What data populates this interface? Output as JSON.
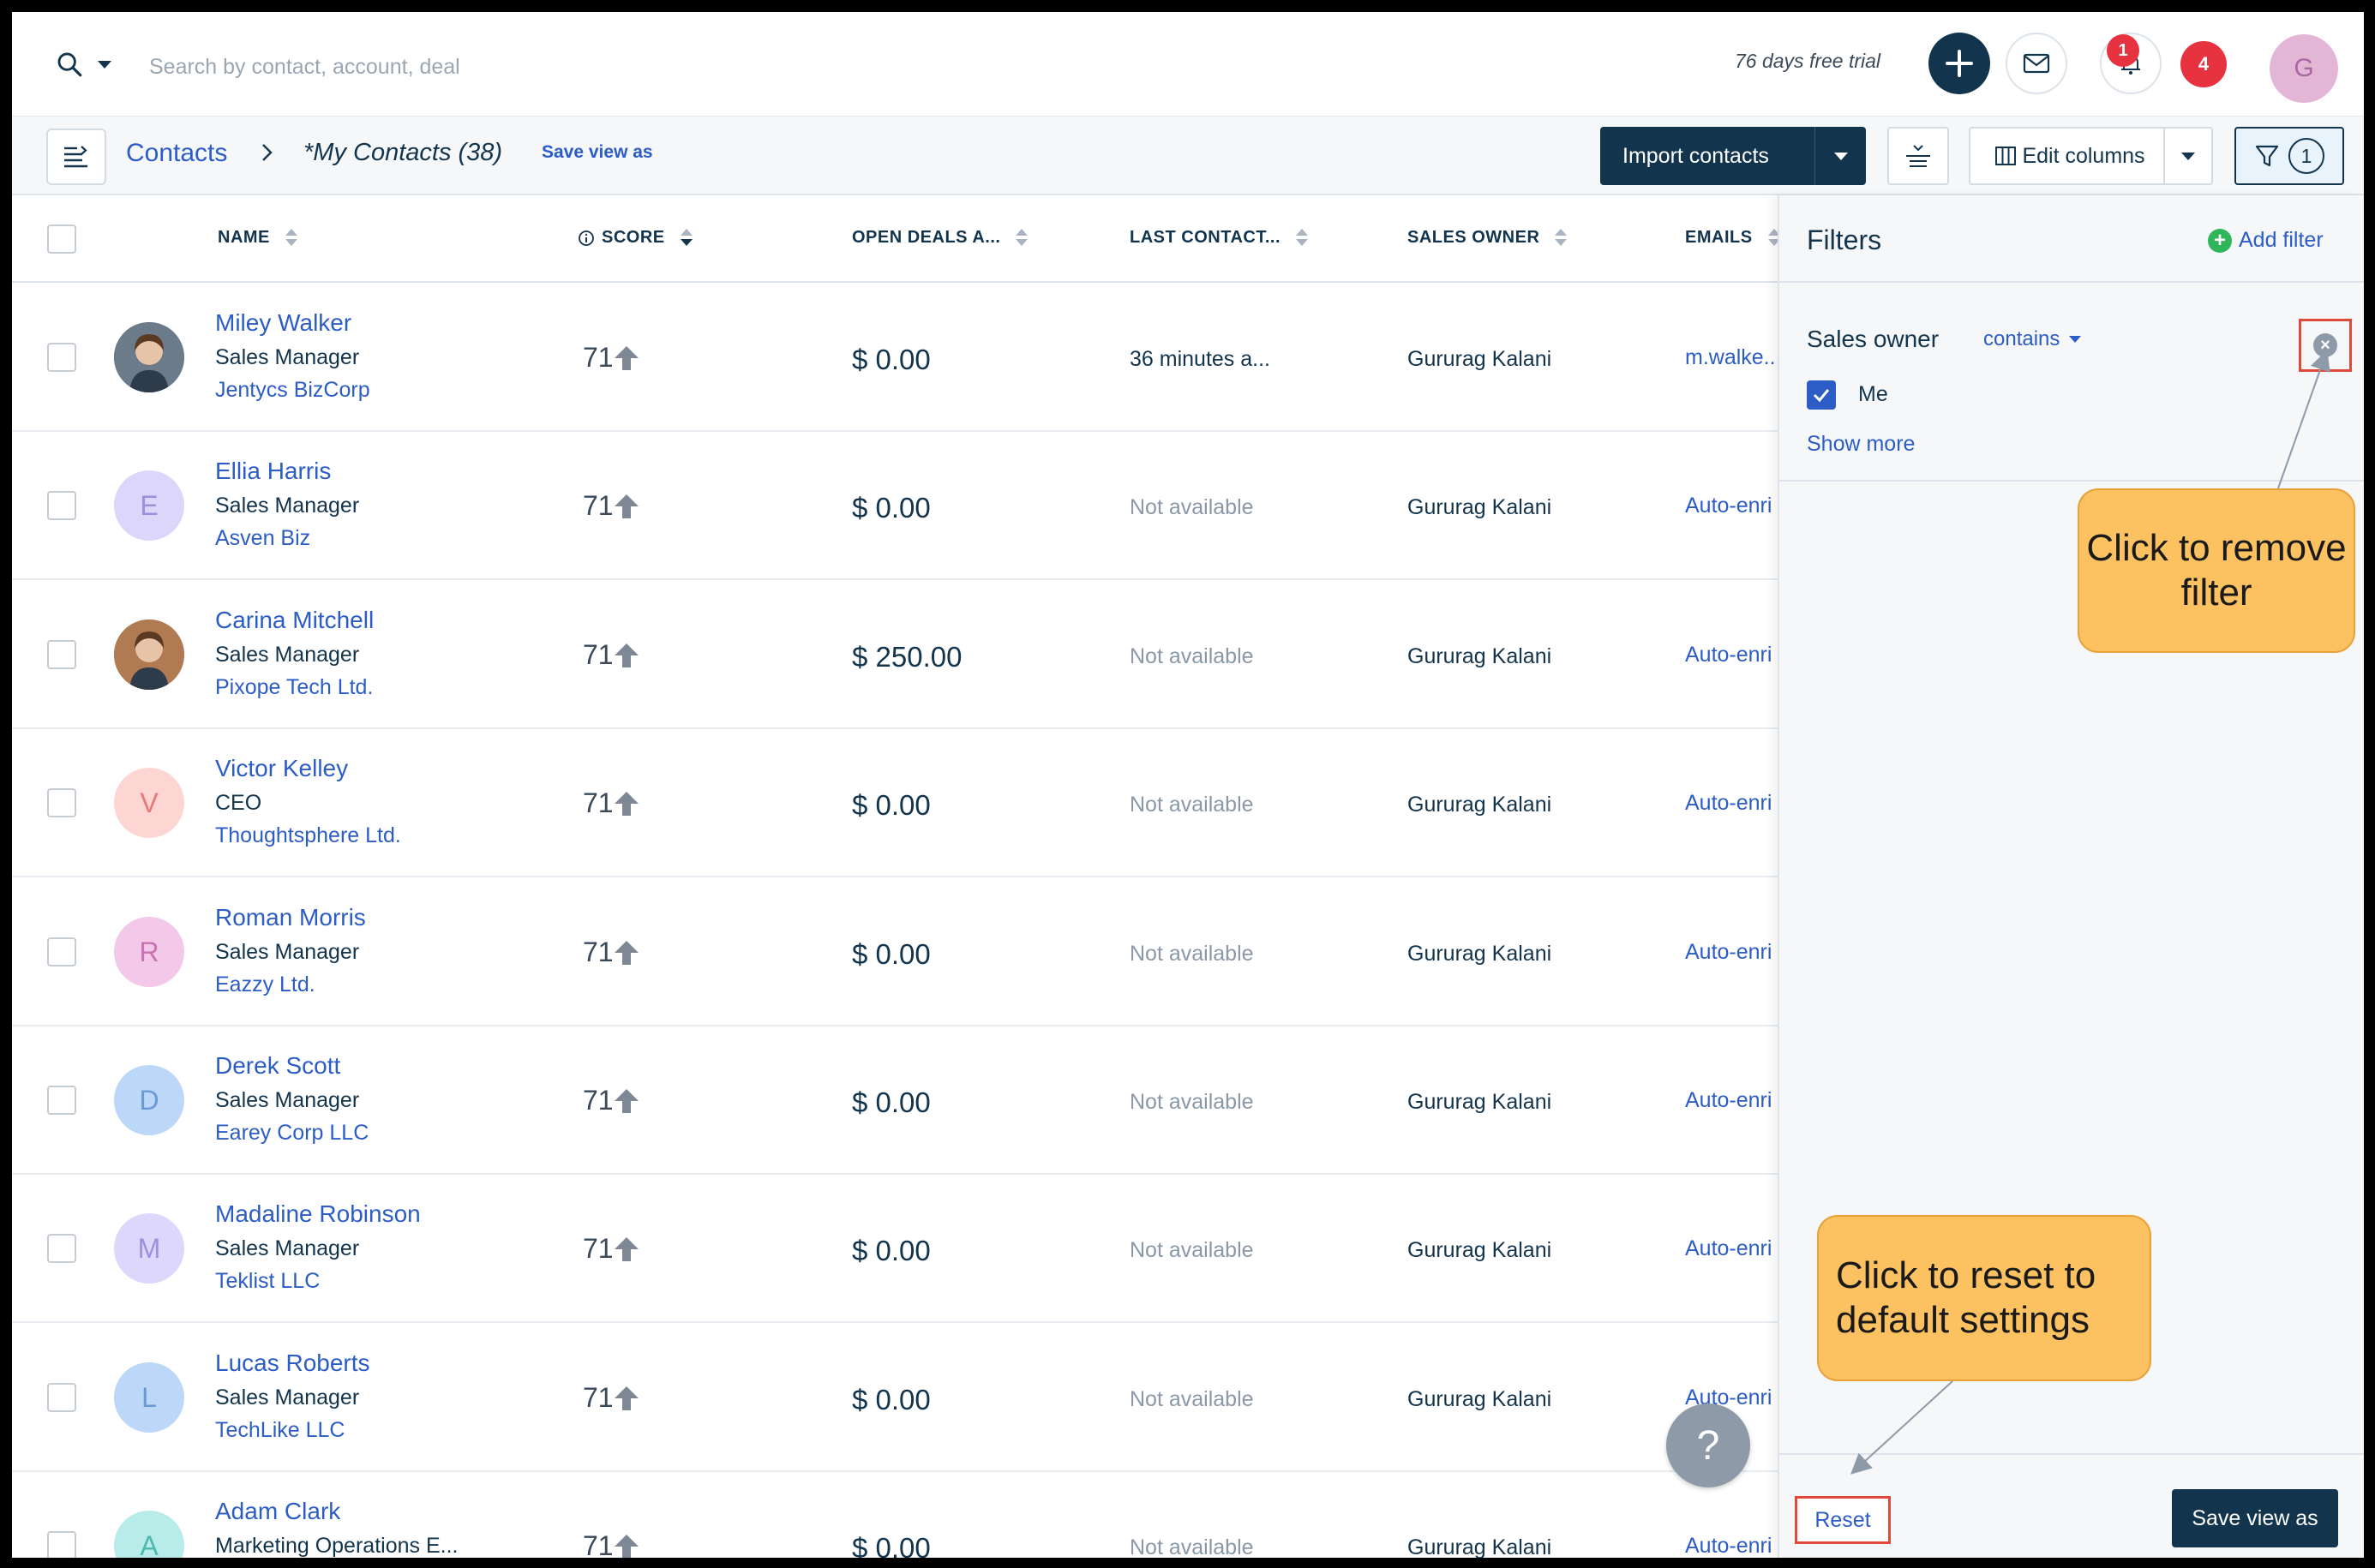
{
  "topbar": {
    "search_placeholder": "Search by contact, account, deal",
    "trial_text": "76 days free trial",
    "notification_count": "1",
    "alert_count": "4",
    "user_initial": "G"
  },
  "viewbar": {
    "breadcrumb_root": "Contacts",
    "view_name": "*My Contacts",
    "view_count": "(38)",
    "save_view_link": "Save view as",
    "import_label": "Import contacts",
    "edit_columns_label": "Edit columns",
    "filter_count": "1"
  },
  "table": {
    "columns": [
      "NAME",
      "SCORE",
      "OPEN DEALS A...",
      "LAST CONTACT...",
      "SALES OWNER",
      "EMAILS"
    ],
    "rows": [
      {
        "name": "Miley Walker",
        "title": "Sales Manager",
        "company": "Jentycs BizCorp",
        "score": "71",
        "deal": "$ 0.00",
        "last": "36 minutes a...",
        "owner": "Gururag Kalani",
        "email": "m.walke...",
        "initial": "",
        "avatar_color": "#6b7b8a",
        "photo": true
      },
      {
        "name": "Ellia Harris",
        "title": "Sales Manager",
        "company": "Asven Biz",
        "score": "71",
        "deal": "$ 0.00",
        "last": "Not available",
        "owner": "Gururag Kalani",
        "email": "Auto-enri",
        "initial": "E",
        "avatar_color": "#dcd6fb",
        "initial_color": "#9b8fe0"
      },
      {
        "name": "Carina Mitchell",
        "title": "Sales Manager",
        "company": "Pixope Tech Ltd.",
        "score": "71",
        "deal": "$ 250.00",
        "last": "Not available",
        "owner": "Gururag Kalani",
        "email": "Auto-enri",
        "initial": "",
        "avatar_color": "#b07a52",
        "photo": true
      },
      {
        "name": "Victor Kelley",
        "title": "CEO",
        "company": "Thoughtsphere Ltd.",
        "score": "71",
        "deal": "$ 0.00",
        "last": "Not available",
        "owner": "Gururag Kalani",
        "email": "Auto-enri",
        "initial": "V",
        "avatar_color": "#fdd5d3",
        "initial_color": "#e8777a"
      },
      {
        "name": "Roman Morris",
        "title": "Sales Manager",
        "company": "Eazzy Ltd.",
        "score": "71",
        "deal": "$ 0.00",
        "last": "Not available",
        "owner": "Gururag Kalani",
        "email": "Auto-enri",
        "initial": "R",
        "avatar_color": "#f3c8e8",
        "initial_color": "#c872b4"
      },
      {
        "name": "Derek Scott",
        "title": "Sales Manager",
        "company": "Earey Corp LLC",
        "score": "71",
        "deal": "$ 0.00",
        "last": "Not available",
        "owner": "Gururag Kalani",
        "email": "Auto-enri",
        "initial": "D",
        "avatar_color": "#bcd7f7",
        "initial_color": "#6a9ad6"
      },
      {
        "name": "Madaline Robinson",
        "title": "Sales Manager",
        "company": "Teklist LLC",
        "score": "71",
        "deal": "$ 0.00",
        "last": "Not available",
        "owner": "Gururag Kalani",
        "email": "Auto-enri",
        "initial": "M",
        "avatar_color": "#ddd7fb",
        "initial_color": "#9d90df"
      },
      {
        "name": "Lucas Roberts",
        "title": "Sales Manager",
        "company": "TechLike LLC",
        "score": "71",
        "deal": "$ 0.00",
        "last": "Not available",
        "owner": "Gururag Kalani",
        "email": "Auto-enri",
        "initial": "L",
        "avatar_color": "#bcd7f7",
        "initial_color": "#6a9ad6"
      },
      {
        "name": "Adam Clark",
        "title": "Marketing Operations E...",
        "company": "",
        "score": "71",
        "deal": "$ 0.00",
        "last": "Not available",
        "owner": "Gururag Kalani",
        "email": "Auto-enri",
        "initial": "A",
        "avatar_color": "#b8ece8",
        "initial_color": "#4fb8b0"
      }
    ]
  },
  "filters": {
    "title": "Filters",
    "add_filter": "Add filter",
    "field": "Sales owner",
    "operator": "contains",
    "option": "Me",
    "show_more": "Show more",
    "reset": "Reset",
    "save_view": "Save view as"
  },
  "callouts": {
    "remove": "Click to remove filter",
    "reset": "Click to reset to default settings"
  },
  "help": "?",
  "colors": {
    "navy": "#12344d",
    "link": "#2c5cc5",
    "callout": "#fcc161",
    "highlight": "#e04a3a"
  }
}
